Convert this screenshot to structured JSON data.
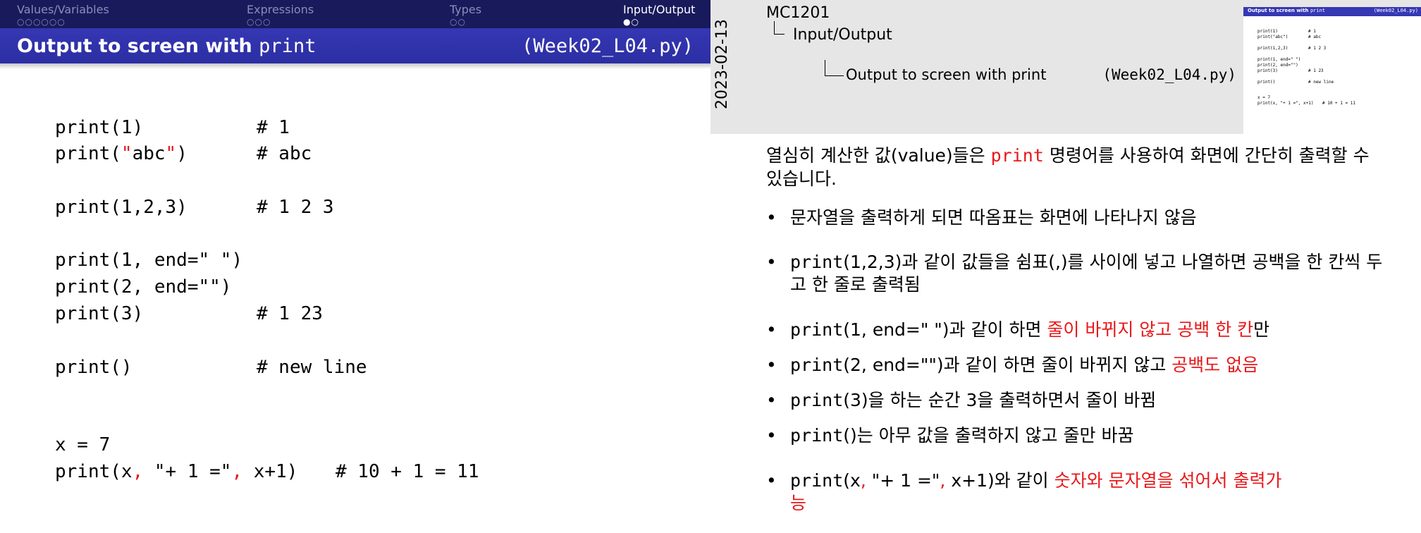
{
  "slide": {
    "nav": {
      "sections": [
        {
          "label": "Values/Variables",
          "dots": "○○○○○○",
          "active": false
        },
        {
          "label": "Expressions",
          "dots": "○○○",
          "active": false
        },
        {
          "label": "Types",
          "dots": "○○",
          "active": false
        },
        {
          "label": "Input/Output",
          "dots": "●○",
          "active": true
        }
      ]
    },
    "title_prefix": "Output to screen with",
    "title_keyword": "print",
    "file": "(Week02_L04.py)",
    "code": {
      "l1": "print(1)",
      "c1": "# 1",
      "l2a": "print(",
      "l2q1": "\"",
      "l2b": "abc",
      "l2q2": "\"",
      "l2c": ")",
      "c2": "# abc",
      "l3": "print(1,2,3)",
      "c3": "# 1 2 3",
      "l4": "print(1, end=\" \")",
      "l5": "print(2, end=\"\")",
      "l6": "print(3)",
      "c6": "# 1 23",
      "l7": "print()",
      "c7": "# new line",
      "l8": "x = 7",
      "l9a": "print(x",
      "l9c1": ",",
      "l9b": " \"+ 1 =\"",
      "l9c2": ",",
      "l9d": " x+1)",
      "c9": "# 10 + 1 = 11"
    }
  },
  "notes": {
    "date": "2023-02-13",
    "course": "MC1201",
    "section": "Input/Output",
    "frame_title": "Output to screen with print",
    "frame_file": "(Week02_L04.py)",
    "intro_1": "열심히 계산한 값(value)들은 ",
    "intro_kw": "print",
    "intro_2": " 명령어를 사용하여 화면에 간단히 출력할 수 있습니다.",
    "b1": "문자열을 출력하게 되면 따옴표는 화면에 나타나지 않음",
    "b2_code": "print",
    "b2_text": "(1,2,3)과 같이 값들을 쉼표(,)를 사이에 넣고 나열하면 공백을 한 칸씩 두고 한 줄로 출력됨",
    "b3_code": "print",
    "b3_mid": "(1, end=\" \")과 같이 하면 ",
    "b3_red": "줄이 바뀌지 않고 공백 한 칸",
    "b3_end": "만",
    "b4_code": "print",
    "b4_mid": "(2, end=\"\")과 같이 하면 줄이 바뀌지 않고 ",
    "b4_red": "공백도 없음",
    "b5_code": "print",
    "b5_text": "(3)을 하는 순간 3을 출력하면서 줄이 바뀜",
    "b6_code": "print",
    "b6_text": "()는 아무 값을 출력하지 않고 줄만 바꿈",
    "b7_code": "print",
    "b7_a": "(x",
    "b7_comma1": ",",
    "b7_b": " \"+ 1 =\"",
    "b7_comma2": ",",
    "b7_c": " x+1)와 같이 ",
    "b7_red": "숫자와 문자열을 섞어서 출력가능"
  },
  "thumb": {
    "title": "Output to screen with",
    "title_kw": "print",
    "file": "(Week02_L04.py)",
    "lines": [
      [
        "print(1)",
        "# 1"
      ],
      [
        "print(\"abc\")",
        "# abc"
      ],
      [
        "print(1,2,3)",
        "# 1 2 3"
      ],
      [
        "print(1, end=\" \")",
        ""
      ],
      [
        "print(2, end=\"\")",
        ""
      ],
      [
        "print(3)",
        "# 1 23"
      ],
      [
        "print()",
        "# new line"
      ],
      [
        "x = 7",
        ""
      ],
      [
        "print(x, \"+ 1 =\", x+1)",
        "# 10 + 1 = 11"
      ]
    ]
  },
  "colors": {
    "nav_bg": "#181a5c",
    "title_bg": "#3537b4",
    "accent_red": "#e8181b",
    "notes_header_bg": "#e6e6e6"
  }
}
